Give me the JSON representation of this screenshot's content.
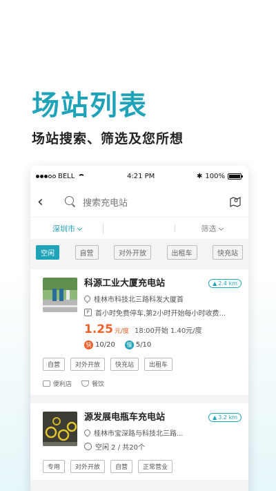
{
  "hero": {
    "title": "场站列表",
    "subtitle": "场站搜索、筛选及您所想"
  },
  "status_bar": {
    "carrier": "BELL",
    "time": "4:21 PM",
    "battery": "100%",
    "battery_level": 1.0
  },
  "search": {
    "placeholder": "搜索充电站"
  },
  "filters": {
    "city": "深圳市",
    "screen": "筛选"
  },
  "tags": [
    {
      "label": "空闲",
      "active": true
    },
    {
      "label": "自营",
      "active": false
    },
    {
      "label": "对外开放",
      "active": false
    },
    {
      "label": "出租车",
      "active": false
    },
    {
      "label": "快充站",
      "active": false
    }
  ],
  "stations": [
    {
      "name": "科源工业大厦充电站",
      "distance": "2.4 km",
      "address": "桂林市科技北三路科发大厦首",
      "parking": "首小时免费停车,第2小时开始每小时收费...",
      "price": "1.25",
      "price_unit": "元/度",
      "next_price": "18:00开始 1.40元/度",
      "fast_label": "快",
      "fast": "10/20",
      "slow_label": "慢",
      "slow": "5/10",
      "tags": [
        "自营",
        "对外开放",
        "快充站",
        "出租车"
      ],
      "amenities": [
        "便利店",
        "餐饮"
      ]
    },
    {
      "name": "源发展电瓶车充电站",
      "distance": "3.2 km",
      "address": "桂林市宝深路与科技北三路...",
      "idle": "空闲 2 / 共20个",
      "tags": [
        "专用",
        "对外开放",
        "自营",
        "正常营业"
      ]
    }
  ],
  "colors": {
    "accent": "#1fa3b8",
    "price": "#f0602a"
  }
}
